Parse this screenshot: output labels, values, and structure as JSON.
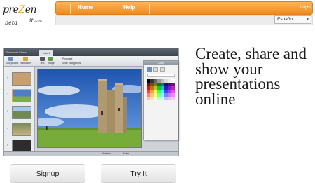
{
  "logo": {
    "main_pre": "pre",
    "main_accent": "Z",
    "main_post": "en",
    "beta": "beta",
    "domain_short": "it",
    "domain_tld": ".com"
  },
  "nav": {
    "home": "Home",
    "help": "Help",
    "login": "Login"
  },
  "language": {
    "selected": "Español"
  },
  "app_preview": {
    "top_text": "Save and Share",
    "active_tab": "Insert",
    "ribbon": [
      "Storyboard",
      "Transitions",
      "Text",
      "Image",
      "Pin mask",
      "Slide background"
    ],
    "color_panel_title": "Color",
    "status": [
      "Abstract",
      "Notes"
    ],
    "slide_numbers": [
      "1",
      "2",
      "3",
      "4",
      "5"
    ]
  },
  "tagline": "Create, share and show your presentations online",
  "buttons": {
    "signup": "Signup",
    "try_it": "Try It"
  },
  "colors": {
    "accent": "#f28a1c",
    "nav_text": "#ffffff",
    "sky": "#3a6fc0",
    "grass": "#78ac3a"
  }
}
